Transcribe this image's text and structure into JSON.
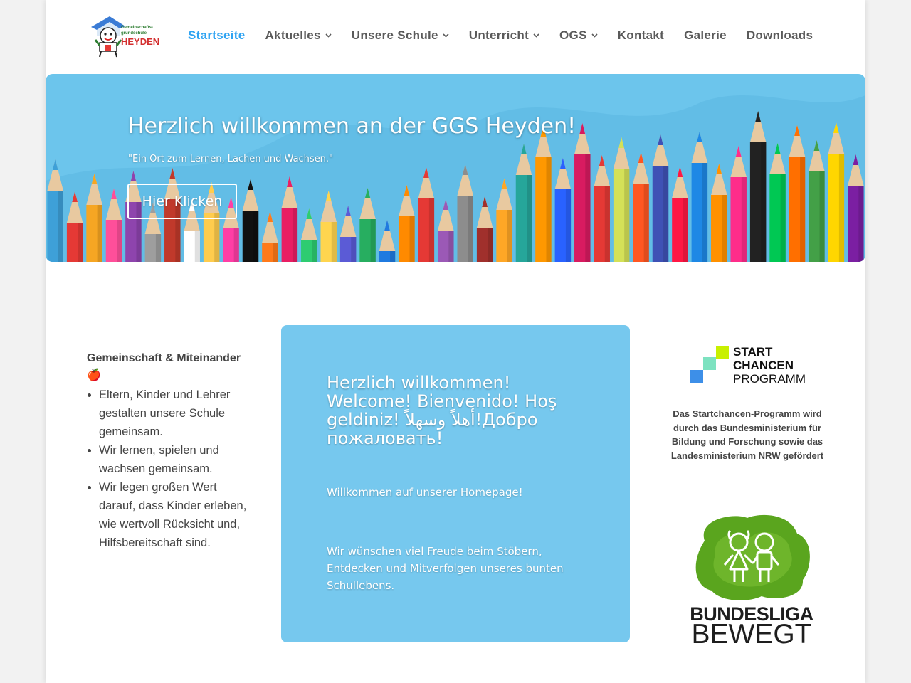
{
  "logo": {
    "line1": "Gemeinschafts-",
    "line2": "grundschule",
    "line3": "HEYDEN"
  },
  "nav": {
    "items": [
      {
        "label": "Startseite",
        "active": true,
        "dropdown": false
      },
      {
        "label": "Aktuelles",
        "active": false,
        "dropdown": true
      },
      {
        "label": "Unsere Schule",
        "active": false,
        "dropdown": true
      },
      {
        "label": "Unterricht",
        "active": false,
        "dropdown": true
      },
      {
        "label": "OGS",
        "active": false,
        "dropdown": true
      },
      {
        "label": "Kontakt",
        "active": false,
        "dropdown": false
      },
      {
        "label": "Galerie",
        "active": false,
        "dropdown": false
      },
      {
        "label": "Downloads",
        "active": false,
        "dropdown": false
      }
    ]
  },
  "hero": {
    "title": "Herzlich willkommen an der GGS Heyden!",
    "subtitle": "\"Ein Ort zum Lernen, Lachen und Wachsen.\"",
    "button_label": "Hier Klicken"
  },
  "left": {
    "heading": "Gemeinschaft & Miteinander🍎",
    "items": [
      "Eltern, Kinder und Lehrer gestalten unsere Schule gemeinsam.",
      "Wir lernen, spielen und wachsen gemeinsam.",
      "Wir legen großen Wert darauf, dass Kinder erleben, wie wertvoll Rücksicht und, Hilfsbereitschaft sind."
    ]
  },
  "center": {
    "title": "Herzlich willkommen! Welcome! Bienvenido! Hoş geldiniz! أهلاً وسهلاً!Добро пожаловать!",
    "welcome": "Willkommen auf unserer Homepage!",
    "wish": "Wir wünschen viel Freude beim Stöbern, Entdecken und Mitverfolgen unseres bunten Schullebens."
  },
  "right": {
    "sc_logo": {
      "line1": "START",
      "line2": "CHANCEN",
      "line3": "PROGRAMM"
    },
    "sc_text": "Das Startchancen-Programm wird durch das Bundesministerium für Bildung und Forschung sowie das Landesministerium NRW gefördert",
    "bb_logo": {
      "line1": "BUNDESLIGA",
      "line2": "BEWEGT"
    }
  },
  "colors": {
    "accent": "#2ea3f2",
    "nav_text": "#5a5a5a",
    "hero_bg": "#6cc5ec",
    "box_bg": "#76c8ee",
    "bb_green": "#5aa51e"
  }
}
